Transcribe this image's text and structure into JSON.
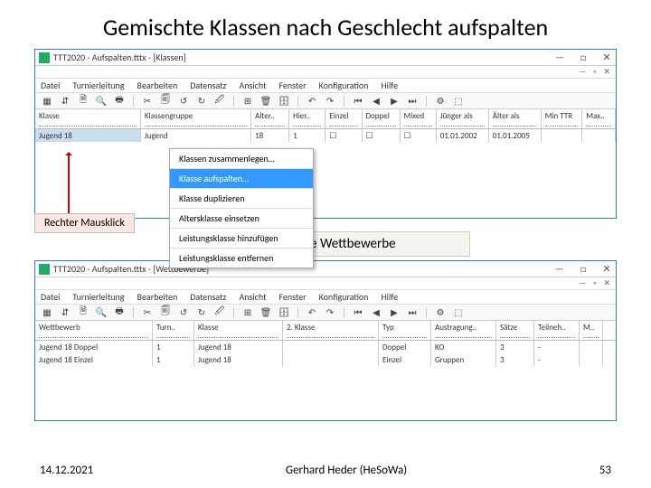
{
  "page_title": "Gemischte Klassen nach Geschlecht aufspalten",
  "window1": {
    "title": "TTT2020 - Aufspalten.tttx - [Klassen]",
    "menus": [
      "Datei",
      "Turnierleitung",
      "Bearbeiten",
      "Datensatz",
      "Ansicht",
      "Fenster",
      "Konfiguration",
      "Hilfe"
    ],
    "columns": [
      "Klasse",
      "Klassengruppe",
      "Alter..",
      "Hier..",
      "Einzel",
      "Doppel",
      "Mixed",
      "Jünger als",
      "Älter als",
      "Min TTR",
      "Max.."
    ],
    "row": {
      "klasse": "Jugend 18",
      "gruppe": "Jugend",
      "alter": "18",
      "hier": "1",
      "jung": "01.01.2002",
      "alt": "01.01.2005"
    }
  },
  "context_menu": {
    "items": [
      "Klassen zusammenlegen…",
      "Klasse aufspalten…",
      "Klasse duplizieren",
      "Altersklasse einsetzen",
      "Leistungsklasse hinzufügen",
      "Leistungsklasse entfernen"
    ],
    "selected_index": 1
  },
  "callout_label": "Rechter Mausklick",
  "section_label": "Zugehörige Wettbewerbe",
  "window2": {
    "title": "TTT2020 - Aufspalten.tttx - [Wettbewerbe]",
    "menus": [
      "Datei",
      "Turnierleitung",
      "Bearbeiten",
      "Datensatz",
      "Ansicht",
      "Fenster",
      "Konfiguration",
      "Hilfe"
    ],
    "columns": [
      "Wettbewerb",
      "Turn..",
      "Klasse",
      "2. Klasse",
      "Typ",
      "Austragung..",
      "Sätze",
      "Teilneh..",
      "M.."
    ],
    "rows": [
      {
        "wb": "Jugend 18 Doppel",
        "t": "1",
        "kl": "Jugend 18",
        "kl2": "",
        "typ": "Doppel",
        "aus": "KO",
        "s": "3",
        "tn": "-"
      },
      {
        "wb": "Jugend 18 Einzel",
        "t": "1",
        "kl": "Jugend 18",
        "kl2": "",
        "typ": "Einzel",
        "aus": "Gruppen",
        "s": "3",
        "tn": "-"
      }
    ]
  },
  "footer": {
    "date": "14.12.2021",
    "author": "Gerhard Heder (HeSoWa)",
    "page": "53"
  }
}
